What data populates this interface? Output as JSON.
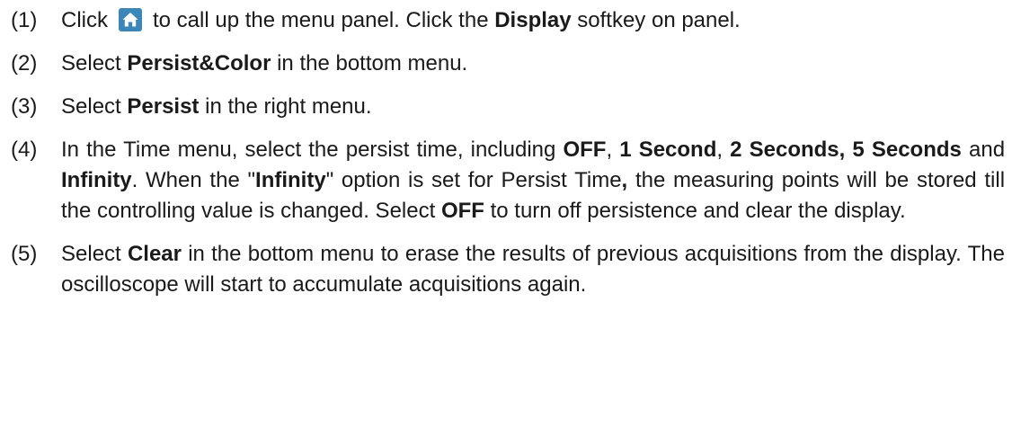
{
  "steps": [
    {
      "num": "(1)",
      "t1": "Click",
      "icon": "home-icon",
      "t2": "to call up the menu panel. Click the",
      "b1": "Display",
      "t3": "softkey on panel."
    },
    {
      "num": "(2)",
      "t1": "Select",
      "b1": "Persist&Color",
      "t2": "in the bottom menu."
    },
    {
      "num": "(3)",
      "t1": "Select",
      "b1": "Persist",
      "t2": "in the right menu."
    },
    {
      "num": "(4)",
      "t1": "In the Time menu, select the persist time, including",
      "b1": "OFF",
      "t2": ",",
      "b2": "1 Second",
      "t3": ",",
      "b3": "2 Seconds, 5 Seconds",
      "t4": "and",
      "b4": "Infinity",
      "t5": ". When the \"",
      "b5": "Infinity",
      "t6": "\" option is set for Persist Time",
      "b6": ",",
      "t7": "the measuring points will be stored till the controlling value is changed. Select",
      "b7": "OFF",
      "t8": "to turn off persistence and clear the display."
    },
    {
      "num": "(5)",
      "t1": "Select",
      "b1": "Clear",
      "t2": "in the bottom menu to erase the results of previous acquisitions from the display. The oscilloscope will start to accumulate acquisitions again."
    }
  ],
  "colors": {
    "icon_bg": "#3d86b8",
    "icon_fg": "#ffffff"
  }
}
